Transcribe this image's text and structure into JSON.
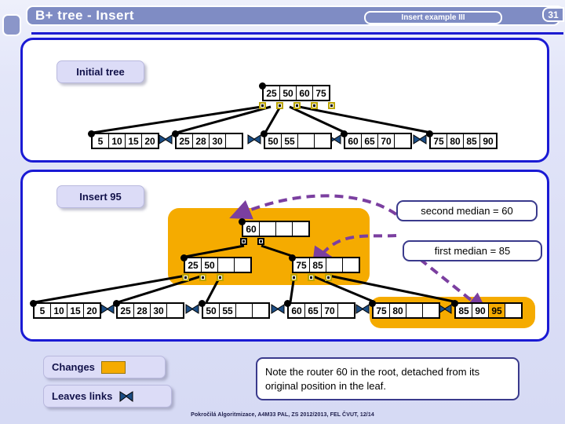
{
  "header": {
    "title": "B+ tree - Insert",
    "subtitle": "Insert example III",
    "page_number": "31"
  },
  "panels": {
    "initial": {
      "label": "Initial tree"
    },
    "insert": {
      "label": "Insert 95"
    }
  },
  "callouts": {
    "second_median": "second median = 60",
    "first_median": "first median = 85",
    "note": "Note the router 60 in the root, detached from its original position in the leaf."
  },
  "legend": {
    "changes_label": "Changes",
    "leaves_links_label": "Leaves links"
  },
  "footer": {
    "text": "Pokročilá Algoritmizace, A4M33 PAL, ZS 2012/2013, FEL ČVUT, 12/14"
  },
  "colors": {
    "accent_blue": "#1a1ad4",
    "header_blue": "#7f8cc4",
    "highlight_orange": "#f5ab00",
    "callout_border": "#3a3a8c",
    "arrow_purple": "#7b3fa0",
    "bowtie_blue": "#1c4e86",
    "label_lavender": "#dcdcf7"
  },
  "trees": {
    "initial": {
      "root": {
        "keys": [
          "25",
          "50",
          "60",
          "75"
        ],
        "empties": 0
      },
      "leaves": [
        {
          "keys": [
            "5",
            "10",
            "15",
            "20"
          ],
          "empties": 0
        },
        {
          "keys": [
            "25",
            "28",
            "30"
          ],
          "empties": 1
        },
        {
          "keys": [
            "50",
            "55"
          ],
          "empties": 2
        },
        {
          "keys": [
            "60",
            "65",
            "70"
          ],
          "empties": 1
        },
        {
          "keys": [
            "75",
            "80",
            "85",
            "90"
          ],
          "empties": 0
        }
      ]
    },
    "after_insert": {
      "root": {
        "keys": [
          "60"
        ],
        "empties": 3
      },
      "internal": [
        {
          "keys": [
            "25",
            "50"
          ],
          "empties": 2
        },
        {
          "keys": [
            "75",
            "85"
          ],
          "empties": 2
        }
      ],
      "leaves": [
        {
          "keys": [
            "5",
            "10",
            "15",
            "20"
          ],
          "empties": 0,
          "highlight": []
        },
        {
          "keys": [
            "25",
            "28",
            "30"
          ],
          "empties": 1,
          "highlight": []
        },
        {
          "keys": [
            "50",
            "55"
          ],
          "empties": 2,
          "highlight": []
        },
        {
          "keys": [
            "60",
            "65",
            "70"
          ],
          "empties": 1,
          "highlight": []
        },
        {
          "keys": [
            "75",
            "80"
          ],
          "empties": 2,
          "highlight": []
        },
        {
          "keys": [
            "85",
            "90",
            "95"
          ],
          "empties": 1,
          "highlight": [
            "95"
          ]
        }
      ]
    }
  }
}
